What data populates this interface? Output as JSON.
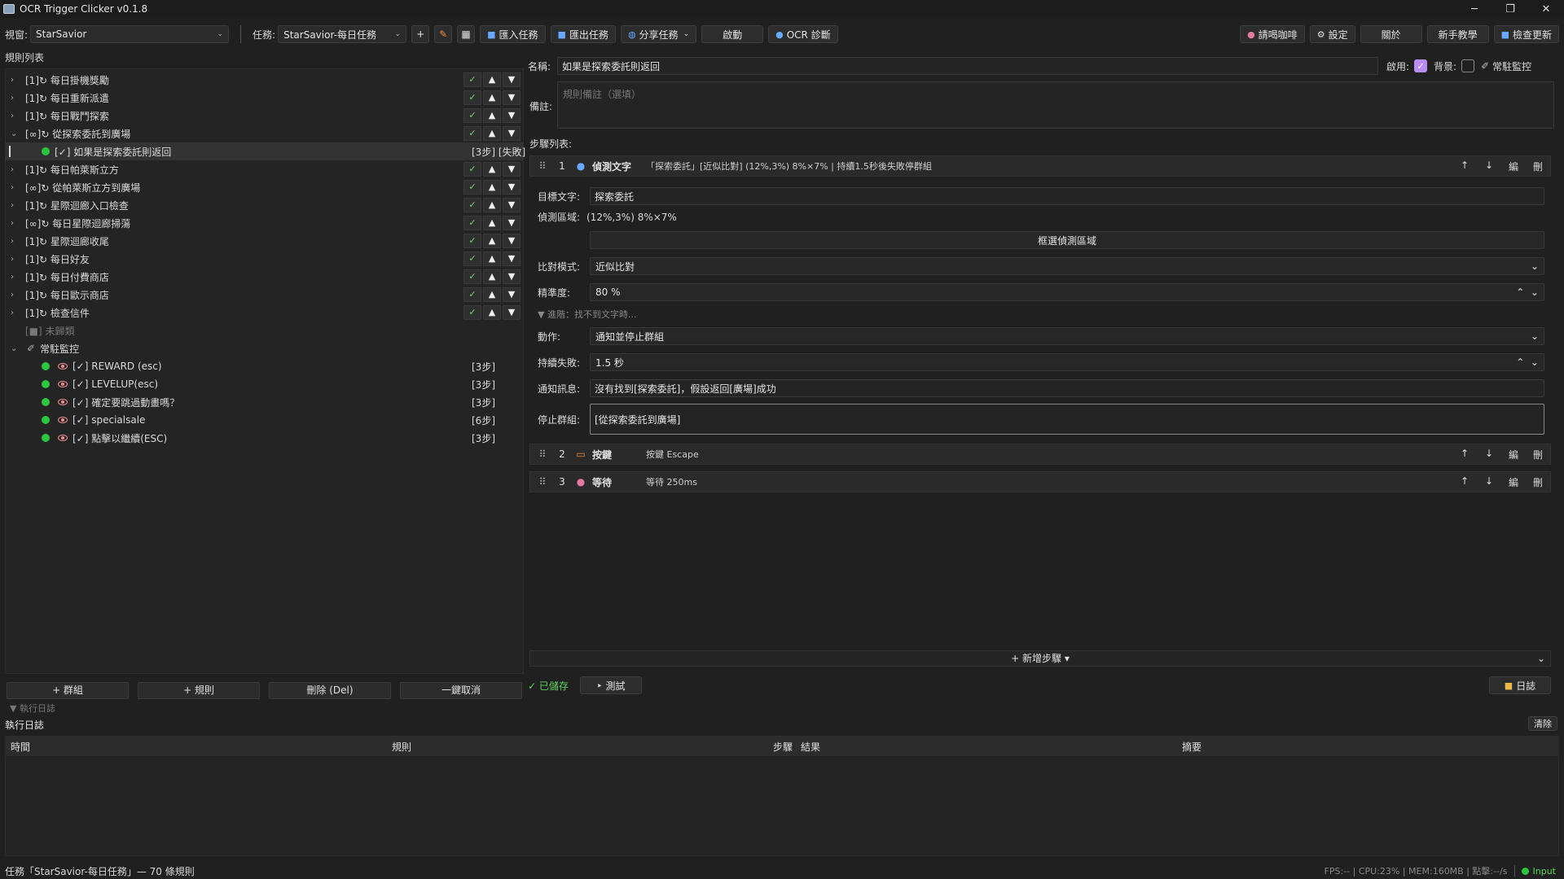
{
  "window": {
    "title": "OCR Trigger Clicker v0.1.8",
    "min": "─",
    "max": "❐",
    "close": "✕"
  },
  "toolbar": {
    "window_label": "視窗:",
    "window_value": "StarSavior",
    "task_label": "任務:",
    "task_value": "StarSavior-每日任務",
    "add": "+",
    "import": "匯入任務",
    "export": "匯出任務",
    "share": "分享任務",
    "start": "啟動",
    "ocr_diag": "OCR 診斷",
    "coffee": "請喝咖啡",
    "settings": "設定",
    "about": "關於",
    "tutorial": "新手教學",
    "update": "檢查更新"
  },
  "rules": {
    "title": "規則列表",
    "items": [
      {
        "label": "[1]↻ 每日掛機獎勵",
        "exp": "›"
      },
      {
        "label": "[1]↻ 每日重新派遣",
        "exp": "›"
      },
      {
        "label": "[1]↻ 每日戰鬥探索",
        "exp": "›"
      },
      {
        "label": "[∞]↻ 從探索委託到廣場",
        "exp": "⌄"
      },
      {
        "label": "[1]↻ 每日帕萊斯立方",
        "exp": "›"
      },
      {
        "label": "[∞]↻ 從帕萊斯立方到廣場",
        "exp": "›"
      },
      {
        "label": "[1]↻ 星際迴廊入口檢查",
        "exp": "›"
      },
      {
        "label": "[∞]↻ 每日星際迴廊掃蕩",
        "exp": "›"
      },
      {
        "label": "[1]↻ 星際迴廊收尾",
        "exp": "›"
      },
      {
        "label": "[1]↻ 每日好友",
        "exp": "›"
      },
      {
        "label": "[1]↻ 每日付費商店",
        "exp": "›"
      },
      {
        "label": "[1]↻ 每日歐示商店",
        "exp": "›"
      },
      {
        "label": "[1]↻ 檢查信件",
        "exp": "›"
      }
    ],
    "selected_child": {
      "label": "[✓] 如果是探索委託則返回",
      "steps": "[3步] [失敗]"
    },
    "ungrouped": "[■] 未歸類",
    "monitor_group": "常駐監控",
    "monitor_items": [
      {
        "label": "[✓] REWARD (esc)",
        "steps": "[3步]"
      },
      {
        "label": "[✓] LEVELUP(esc)",
        "steps": "[3步]"
      },
      {
        "label": "[✓] 確定要跳過動畫嗎？",
        "steps": "[3步]"
      },
      {
        "label": "[✓] specialsale",
        "steps": "[6步]"
      },
      {
        "label": "[✓] 點擊以繼續(ESC)",
        "steps": "[3步]"
      }
    ],
    "ctrl_check": "✓",
    "ctrl_up": "▲",
    "ctrl_down": "▼"
  },
  "left_buttons": {
    "add_group": "+ 群組",
    "add_rule": "+ 規則",
    "delete": "刪除 (Del)",
    "cancel_all": "一鍵取消"
  },
  "editor": {
    "name_label": "名稱:",
    "name_value": "如果是探索委託則返回",
    "enable_label": "啟用:",
    "bg_label": "背景:",
    "monitor_label": "常駐監控",
    "note_label": "備註:",
    "note_placeholder": "規則備註（選填）",
    "steps_title": "步驟列表:",
    "steps": [
      {
        "num": "1",
        "type": "偵測文字",
        "desc": "「探索委託」[近似比對] (12%,3%) 8%×7% | 持續1.5秒後失敗停群組"
      },
      {
        "num": "2",
        "type": "按鍵",
        "desc": "按鍵 Escape"
      },
      {
        "num": "3",
        "type": "等待",
        "desc": "等待 250ms"
      }
    ],
    "step_actions": {
      "up": "↑",
      "down": "↓",
      "edit": "編",
      "del": "刪"
    },
    "target_label": "目標文字:",
    "target_value": "探索委託",
    "region_label": "偵測區域:",
    "region_value": "(12%,3%) 8%×7%",
    "region_btn": "框選偵測區域",
    "match_label": "比對模式:",
    "match_value": "近似比對",
    "accuracy_label": "精準度:",
    "accuracy_value": "80 %",
    "advanced": "▼ 進階：找不到文字時...",
    "action_label": "動作:",
    "action_value": "通知並停止群組",
    "persist_label": "持續失敗:",
    "persist_value": "1.5 秒",
    "notify_label": "通知訊息:",
    "notify_value": "沒有找到[探索委託]，假設返回[廣場]成功",
    "stopgroup_label": "停止群組:",
    "stopgroup_value": "[從探索委託到廣場]",
    "add_step": "+ 新增步驟 ▾",
    "saved": "✓ 已儲存",
    "test": "‣ 測試",
    "log_btn": "日誌"
  },
  "log": {
    "collapse": "▼ 執行日誌",
    "title": "執行日誌",
    "clear": "清除",
    "columns": [
      "時間",
      "規則",
      "步驟",
      "結果",
      "摘要"
    ]
  },
  "status": {
    "left": "任務「StarSavior-每日任務」— 70 條規則",
    "stats": "FPS:-- | CPU:23% | MEM:160MB | 點擊:--/s",
    "input": "Input"
  }
}
